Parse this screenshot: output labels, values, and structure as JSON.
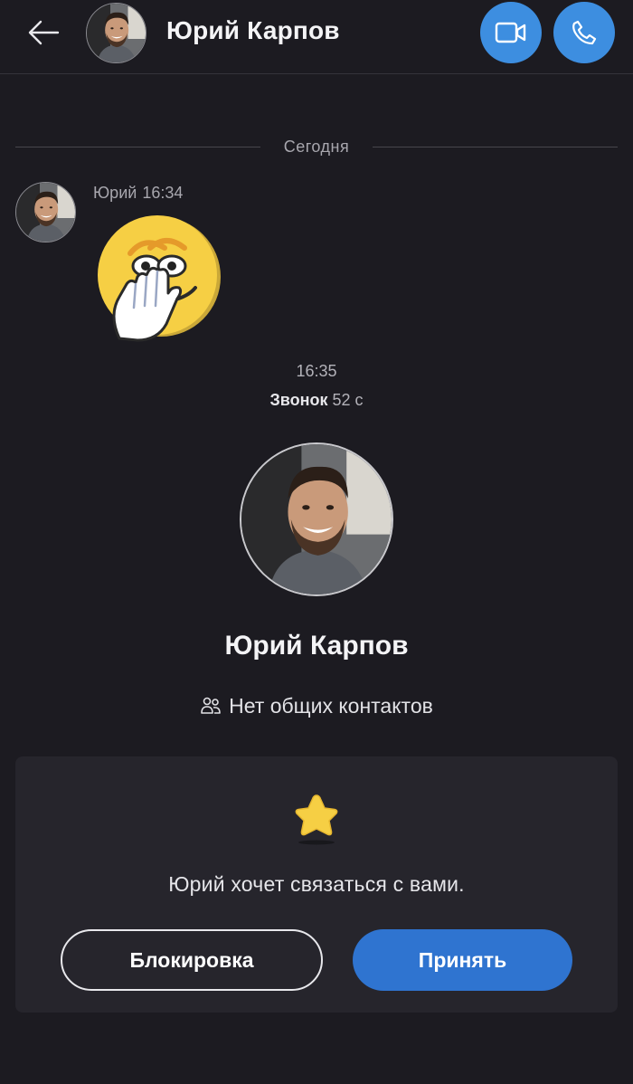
{
  "header": {
    "contact_name": "Юрий Карпов",
    "icons": {
      "back": "arrow-left-icon",
      "video": "video-camera-icon",
      "call": "phone-icon"
    },
    "accent_color": "#3d8ee0"
  },
  "conversation": {
    "date_separator": "Сегодня",
    "message": {
      "sender": "Юрий",
      "time": "16:34",
      "sticker": "hand-over-mouth-emoji"
    },
    "call": {
      "time": "16:35",
      "label": "Звонок",
      "duration": "52 с"
    }
  },
  "profile": {
    "name": "Юрий Карпов",
    "mutual_contacts": "Нет общих контактов"
  },
  "request_card": {
    "icon": "star-icon",
    "text": "Юрий хочет связаться с вами.",
    "block_label": "Блокировка",
    "accept_label": "Принять",
    "accept_color": "#2f74d0"
  }
}
